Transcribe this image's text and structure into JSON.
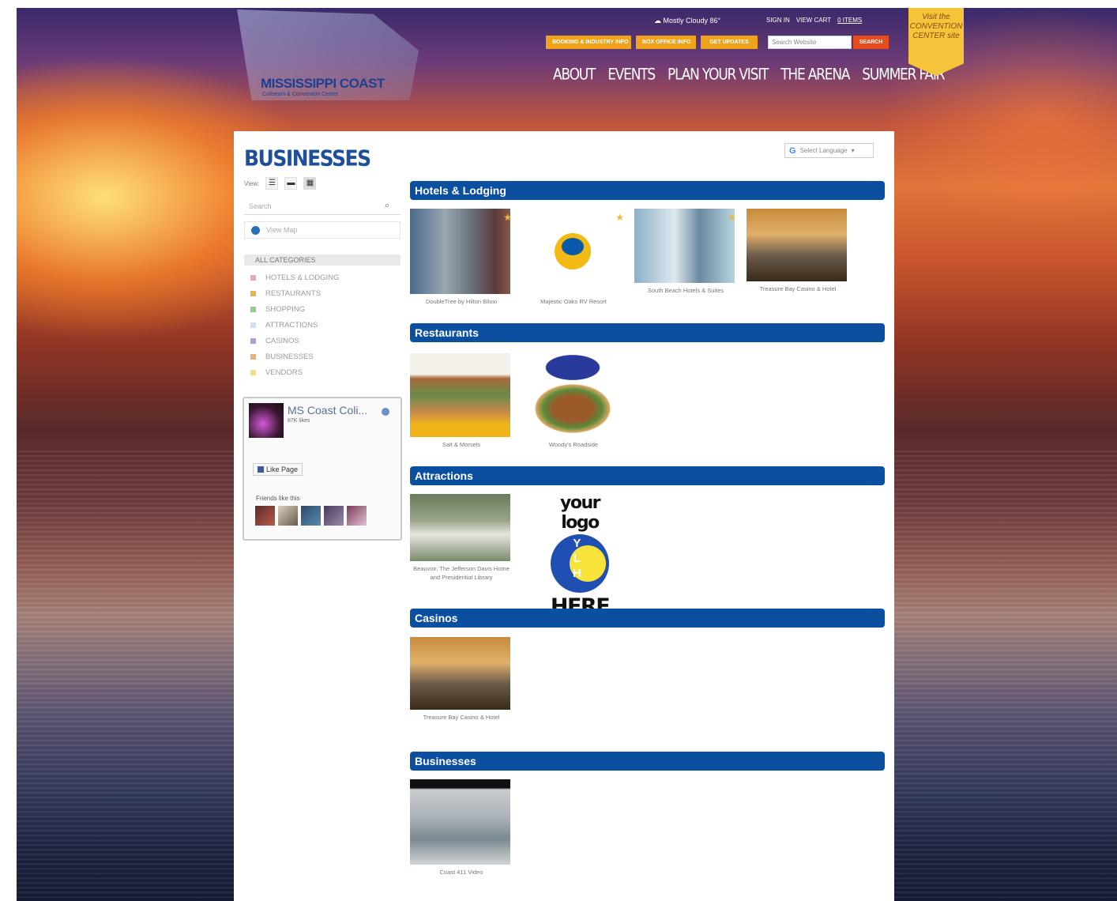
{
  "header": {
    "logo_name": "MISSISSIPPI COAST",
    "logo_sub": "Coliseum & Convention Center",
    "weather": "Mostly Cloudy 86°",
    "top_links": [
      "SIGN IN",
      "VIEW CART",
      "0 ITEMS"
    ],
    "orange_buttons": [
      "BOOKING & INDUSTRY INFO",
      "BOX OFFICE INFO",
      "GET UPDATES"
    ],
    "search_placeholder": "Search Website",
    "search_button": "SEARCH",
    "nav": [
      "ABOUT",
      "EVENTS",
      "PLAN YOUR VISIT",
      "THE ARENA",
      "SUMMER FAIR"
    ],
    "badge": "Visit the CONVENTION CENTER site"
  },
  "sidebar": {
    "title": "BUSINESSES",
    "view_label": "View:",
    "search_placeholder": "Search",
    "map_view_label": "View Map",
    "all_categories": "ALL CATEGORIES",
    "categories": [
      {
        "label": "HOTELS & LODGING",
        "color": "#e6a6c8"
      },
      {
        "label": "RESTAURANTS",
        "color": "#e8b64a"
      },
      {
        "label": "SHOPPING",
        "color": "#8ed28a"
      },
      {
        "label": "ATTRACTIONS",
        "color": "#cfe0f2"
      },
      {
        "label": "CASINOS",
        "color": "#b69ad6"
      },
      {
        "label": "BUSINESSES",
        "color": "#eab07a"
      },
      {
        "label": "VENDORS",
        "color": "#f2e07a"
      }
    ]
  },
  "facebook": {
    "page_name": "MS Coast Coli...",
    "likes": "87K likes",
    "like_button": "Like Page",
    "friends": "Friends like this"
  },
  "language_select": "Select Language",
  "sections": [
    {
      "title": "Hotels & Lodging",
      "items": [
        {
          "caption": "DoubleTree by Hilton Biloxi",
          "icon": "hotel-tower-photo"
        },
        {
          "caption": "Majestic Oaks RV Resort",
          "icon": "majestic-oaks-logo"
        },
        {
          "caption": "South Beach Hotels & Suites",
          "icon": "ocean-view-room-photo"
        },
        {
          "caption": "Treasure Bay Casino & Hotel",
          "icon": "casino-building-photo"
        }
      ]
    },
    {
      "title": "Restaurants",
      "items": [
        {
          "caption": "Salt & Morsels",
          "icon": "food-collage-photo"
        },
        {
          "caption": "Woody's Roadside",
          "icon": "burger-photo"
        }
      ]
    },
    {
      "title": "Attractions",
      "items": [
        {
          "caption": "Beauvoir, The Jefferson Davis Home and Presidential Library",
          "icon": "oak-house-photo"
        }
      ],
      "placeholder_logo": {
        "top": "your logo",
        "letters": "Y\nL\nH",
        "bottom": "HERE"
      }
    },
    {
      "title": "Casinos",
      "items": [
        {
          "caption": "Treasure Bay Casino & Hotel",
          "icon": "casino-building-photo"
        }
      ]
    },
    {
      "title": "Businesses",
      "items": [
        {
          "caption": "Coast 411 Video",
          "icon": "highway-photo"
        }
      ]
    }
  ]
}
